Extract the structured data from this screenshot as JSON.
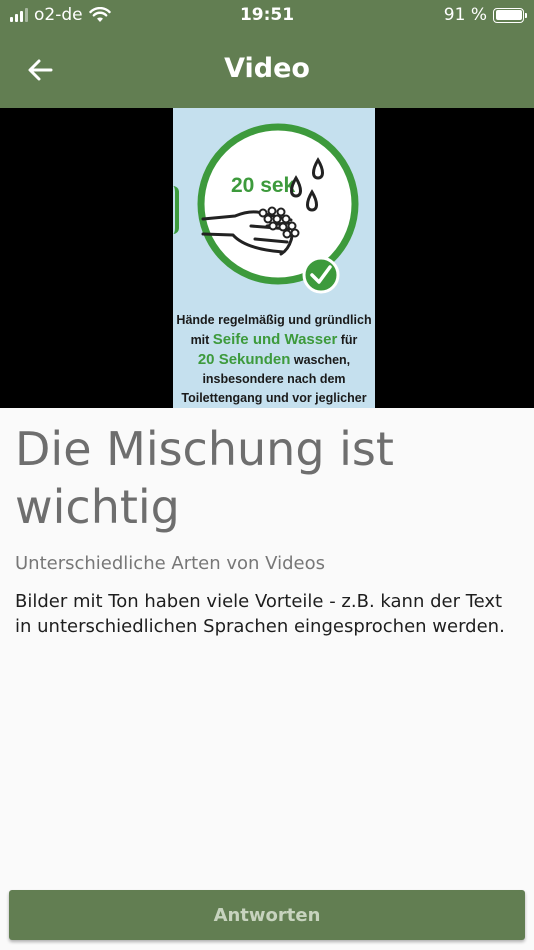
{
  "status_bar": {
    "carrier": "o2-de",
    "time": "19:51",
    "battery": "91 %"
  },
  "app_bar": {
    "title": "Video"
  },
  "video": {
    "poster_timer": "20 sek",
    "caption_line1": "Hände regelmäßig und gründlich",
    "caption_line2_pre": "mit ",
    "caption_line2_hl": "Seife und Wasser",
    "caption_line2_post": " für",
    "caption_line3_hl": "20 Sekunden",
    "caption_line3_post": " waschen,",
    "caption_line4": "insbesondere nach dem",
    "caption_line5": "Toilettengang und vor jeglicher"
  },
  "content": {
    "heading": "Die Mischung ist wichtig",
    "subtitle": "Unterschiedliche Arten von Videos",
    "body": "Bilder mit Ton haben viele Vorteile - z.B. kann der Text in unterschiedlichen Sprachen eingesprochen werden."
  },
  "footer": {
    "answer_label": "Antworten"
  },
  "colors": {
    "primary": "#627e52",
    "accent_green": "#3d9a3c",
    "poster_bg": "#c5e0ee"
  }
}
